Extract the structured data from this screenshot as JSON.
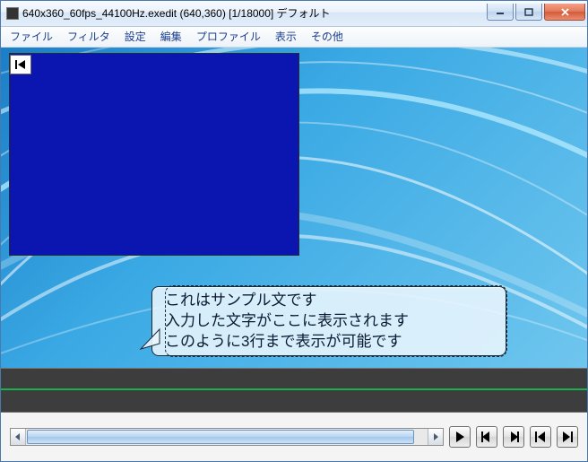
{
  "window": {
    "title": "640x360_60fps_44100Hz.exedit (640,360)  [1/18000]  デフォルト"
  },
  "menu": {
    "file": "ファイル",
    "filter": "フィルタ",
    "settings": "設定",
    "edit": "編集",
    "profile": "プロファイル",
    "view": "表示",
    "other": "その他"
  },
  "speech": {
    "line1": "これはサンプル文です",
    "line2": "入力した文字がここに表示されます",
    "line3": "このように3行まで表示が可能です"
  },
  "icons": {
    "seek_start": "seek-start-icon",
    "play": "play-icon",
    "step_back": "step-back-icon",
    "step_fwd": "step-forward-icon",
    "jump_start": "jump-start-icon",
    "jump_end": "jump-end-icon",
    "minimize": "minimize-icon",
    "maximize": "maximize-icon",
    "close": "close-icon"
  }
}
